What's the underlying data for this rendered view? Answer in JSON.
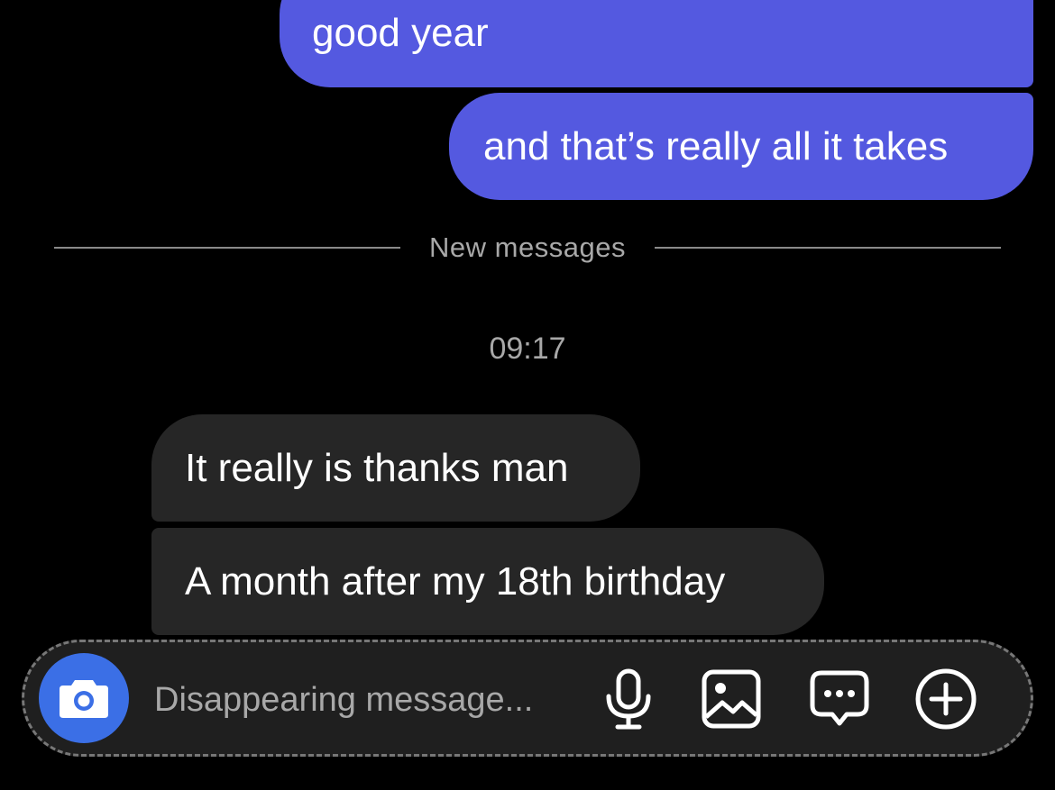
{
  "messages": {
    "sent": [
      {
        "text": "good year"
      },
      {
        "text": "and that’s really all it takes"
      }
    ],
    "divider_label": "New messages",
    "timestamp": "09:17",
    "received": [
      {
        "text": "It really is thanks man"
      },
      {
        "text": "A month after my 18th birthday"
      }
    ]
  },
  "composer": {
    "placeholder": "Disappearing message...",
    "icons": [
      "camera-icon",
      "microphone-icon",
      "image-icon",
      "sticker-icon",
      "plus-icon"
    ]
  },
  "colors": {
    "background": "#000000",
    "sent_bubble": "#5459e0",
    "received_bubble": "#262626",
    "camera_button": "#3b6fe6",
    "muted_text": "#a8a8a8"
  }
}
